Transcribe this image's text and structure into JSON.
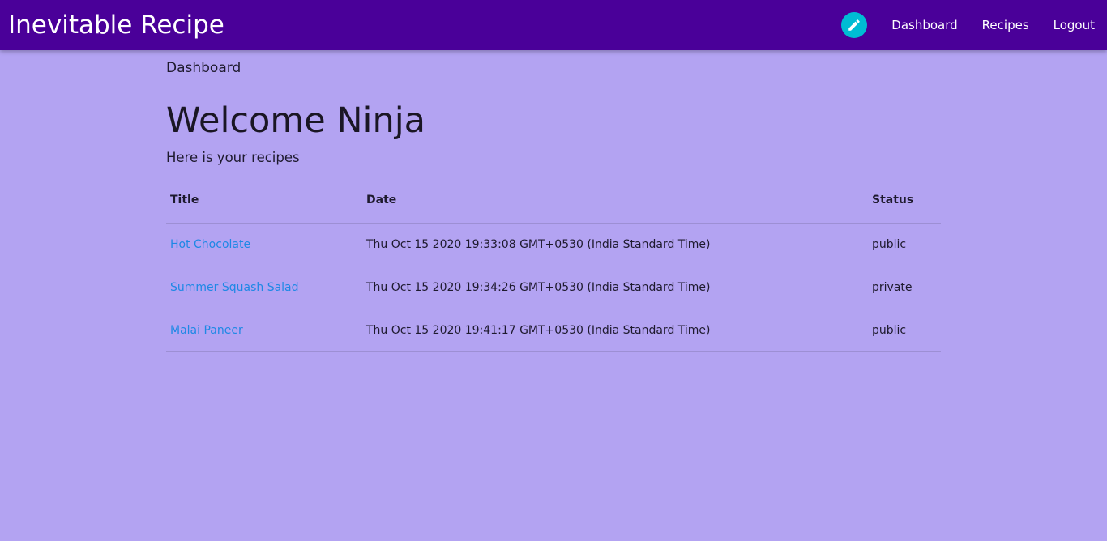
{
  "navbar": {
    "brand": "Inevitable Recipe",
    "edit_icon": "pencil-icon",
    "links": [
      "Dashboard",
      "Recipes",
      "Logout"
    ]
  },
  "breadcrumb": "Dashboard",
  "page_title": "Welcome Ninja",
  "subtitle": "Here is your recipes",
  "table": {
    "headers": [
      "Title",
      "Date",
      "Status"
    ],
    "rows": [
      {
        "title": "Hot Chocolate",
        "date": "Thu Oct 15 2020 19:33:08 GMT+0530 (India Standard Time)",
        "status": "public"
      },
      {
        "title": "Summer Squash Salad",
        "date": "Thu Oct 15 2020 19:34:26 GMT+0530 (India Standard Time)",
        "status": "private"
      },
      {
        "title": "Malai Paneer",
        "date": "Thu Oct 15 2020 19:41:17 GMT+0530 (India Standard Time)",
        "status": "public"
      }
    ]
  },
  "colors": {
    "navbar": "#4a0099",
    "background": "#b3a3f2",
    "fab": "#00bcd4",
    "link": "#1e88e5"
  }
}
